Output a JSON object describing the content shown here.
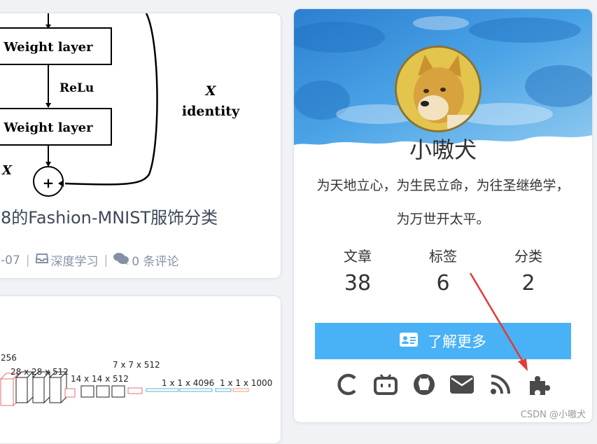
{
  "post": {
    "diagram": {
      "weight_layer_1": "Weight layer",
      "relu": "ReLu",
      "weight_layer_2": "Weight layer",
      "x_left": "X",
      "x_right": "X",
      "identity": "identity",
      "plus": "+"
    },
    "title": "8的Fashion-MNIST服饰分类",
    "meta": {
      "date": "-07",
      "category": "深度学习",
      "comments": "0 条评论"
    }
  },
  "post2": {
    "diagram_labels": [
      "256",
      "28 x 28 x 512",
      "14 x 14 x 512",
      "7 x 7 x 512",
      "1 x 1 x 4096",
      "1 x 1 x 1000"
    ]
  },
  "author": {
    "name": "小嗷犬",
    "motto": "为天地立心，为生民立命，为往圣继绝学，为万世开太平。",
    "stats": [
      {
        "label": "文章",
        "value": "38"
      },
      {
        "label": "标签",
        "value": "6"
      },
      {
        "label": "分类",
        "value": "2"
      }
    ],
    "more_button": "了解更多",
    "socials": [
      "csdn-icon",
      "bilibili-icon",
      "github-icon",
      "email-icon",
      "rss-icon",
      "puzzle-icon"
    ],
    "accent_color": "#49b1f5"
  },
  "watermark": "CSDN @小嗷犬"
}
